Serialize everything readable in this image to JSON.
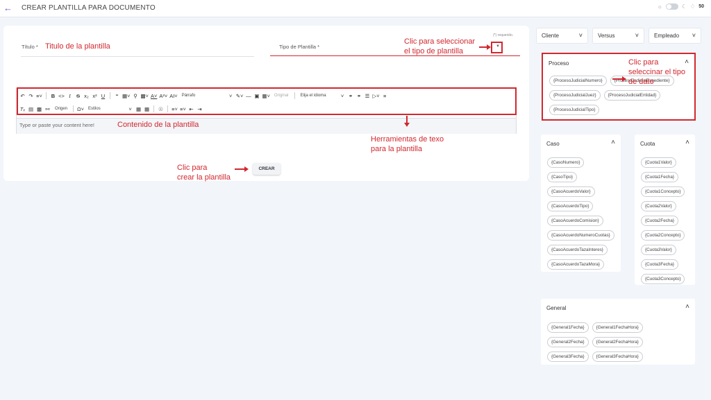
{
  "header": {
    "back_icon": "arrow-left-icon",
    "title": "CREAR PLANTILLA PARA DOCUMENTO",
    "notification_count": "50"
  },
  "form": {
    "required_note": "(*) requerido.",
    "titulo_label": "Título *",
    "tipo_label": "Tipo de Plantilla *",
    "editor_placeholder": "Type or paste your content here!",
    "create_button": "CREAR"
  },
  "toolbar": {
    "row1_icons": [
      "undo-icon",
      "redo-icon",
      "align-icon",
      "bold-icon",
      "code-icon",
      "italic-icon",
      "strikethrough-icon",
      "subscript-icon",
      "superscript-icon",
      "underline-icon",
      "blockquote-icon",
      "template-icon",
      "find-icon",
      "highlight-icon",
      "font-color-icon",
      "font-size-icon",
      "font-family-icon"
    ],
    "paragraph_select": "Párrafo",
    "image_original": "Original",
    "language_select": "Elija el idioma",
    "origen_label": "Origen",
    "styles_select": "Estilos"
  },
  "annotations": {
    "titulo": "Titulo de la plantilla",
    "tipo_line1": "Clic para seleccionar",
    "tipo_line2": "el tipo de plantilla",
    "contenido": "Contenido de la plantilla",
    "herramientas_line1": "Herramientas de texo",
    "herramientas_line2": "para la plantilla",
    "crear_line1": "Clic para",
    "crear_line2": "crear la plantilla",
    "dato_line1": "Clic para",
    "dato_line2": "seleccinar el tipo",
    "dato_line3": "de dato"
  },
  "dropdowns": [
    {
      "label": "Cliente"
    },
    {
      "label": "Versus"
    },
    {
      "label": "Empleado"
    }
  ],
  "panels": {
    "proceso": {
      "title": "Proceso",
      "chips": [
        "{ProcesoJudicialNumero}",
        "{ProcesoJudicialExpediente}",
        "{ProcesoJudicialJuez}",
        "{ProcesoJudicialEntidad}",
        "{ProcesoJudicialTipo}"
      ]
    },
    "caso": {
      "title": "Caso",
      "chips": [
        "{CasoNumero}",
        "{CasoTipo}",
        "{CasoAcuerdoValor}",
        "{CasoAcuerdoTipo}",
        "{CasoAcuerdoComision}",
        "{CasoAcuerdoNumeroCuotas}",
        "{CasoAcuerdoTazaInteres}",
        "{CasoAcuerdoTazaMora}"
      ]
    },
    "cuota": {
      "title": "Cuota",
      "chips": [
        "{Cuota1Valor}",
        "{Cuota1Fecha}",
        "{Cuota1Concepto}",
        "{Cuota2Valor}",
        "{Cuota2Fecha}",
        "{Cuota2Concepto}",
        "{Cuota3Valor}",
        "{Cuota3Fecha}",
        "{Cuota3Concepto}"
      ]
    },
    "general": {
      "title": "General",
      "chips": [
        "{General1Fecha}",
        "{General1FechaHora}",
        "{General2Fecha}",
        "{General2FechaHora}",
        "{General3Fecha}",
        "{General3FechaHora}"
      ]
    }
  },
  "colors": {
    "accent": "#7a4fc7",
    "annotation": "#d1272e"
  }
}
